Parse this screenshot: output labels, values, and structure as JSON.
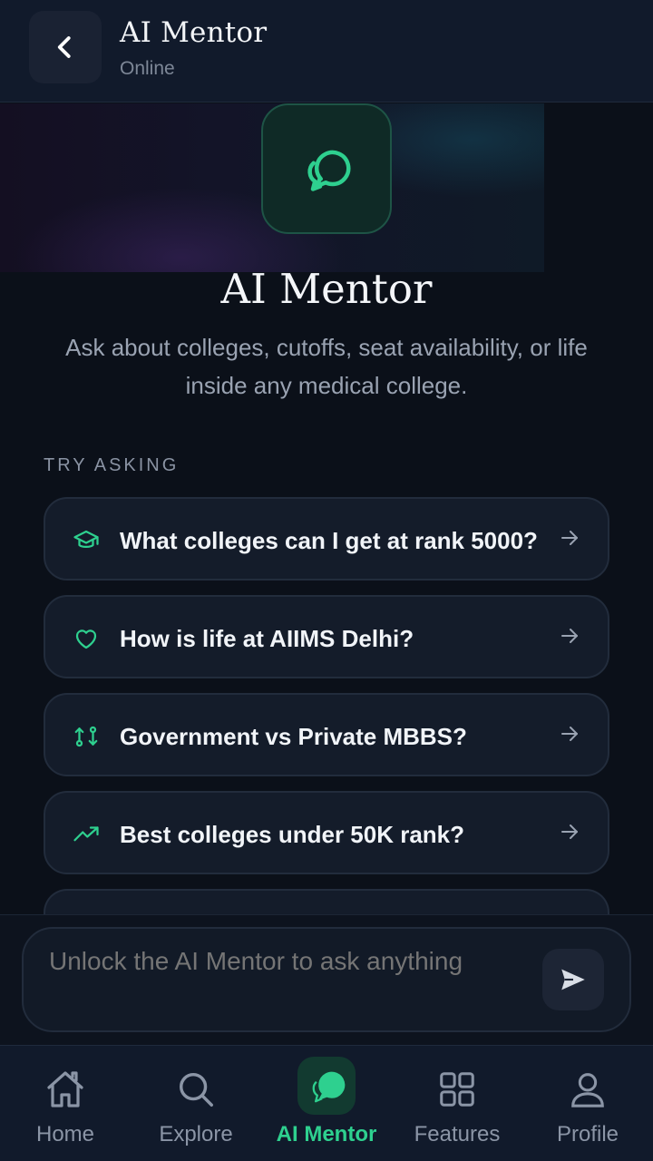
{
  "header": {
    "title": "AI Mentor",
    "status": "Online",
    "back_icon": "chevron-left-icon"
  },
  "hero": {
    "icon": "chat-bubbles-icon",
    "title": "AI Mentor",
    "description": "Ask about colleges, cutoffs, seat availability, or life inside any medical college."
  },
  "suggestions": {
    "heading": "TRY ASKING",
    "items": [
      {
        "icon": "graduation-cap-icon",
        "label": "What colleges can I get at rank 5000?"
      },
      {
        "icon": "heart-icon",
        "label": "How is life at AIIMS Delhi?"
      },
      {
        "icon": "compare-arrows-icon",
        "label": "Government vs Private MBBS?"
      },
      {
        "icon": "trending-up-icon",
        "label": "Best colleges under 50K rank?"
      }
    ]
  },
  "composer": {
    "placeholder": "Unlock the AI Mentor to ask anything",
    "send_icon": "send-icon"
  },
  "nav": {
    "items": [
      {
        "label": "Home",
        "icon": "home-icon"
      },
      {
        "label": "Explore",
        "icon": "search-icon"
      },
      {
        "label": "AI Mentor",
        "icon": "chat-bubbles-icon",
        "active": true
      },
      {
        "label": "Features",
        "icon": "grid-icon"
      },
      {
        "label": "Profile",
        "icon": "user-icon"
      }
    ]
  },
  "colors": {
    "accent": "#2ed08f",
    "background": "#0b1019",
    "header": "#111a2b",
    "card": "#141c2a"
  }
}
